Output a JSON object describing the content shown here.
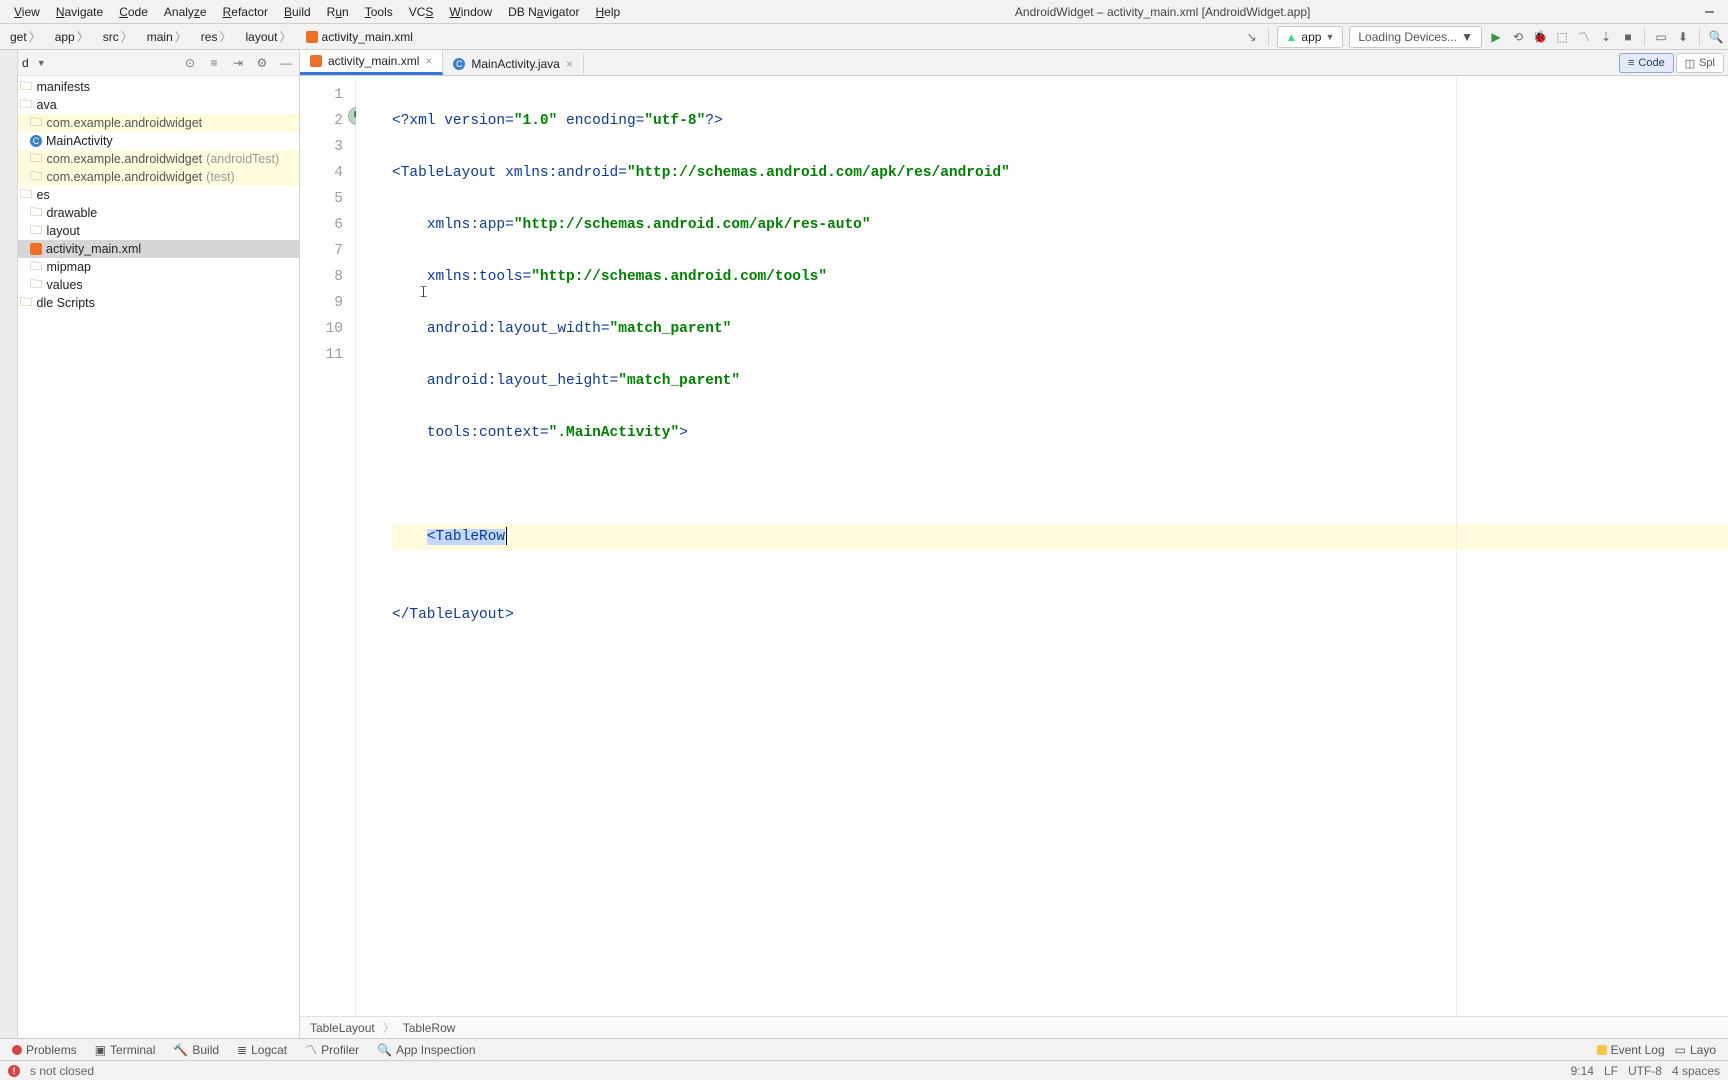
{
  "menubar": {
    "items": [
      "View",
      "Navigate",
      "Code",
      "Analyze",
      "Refactor",
      "Build",
      "Run",
      "Tools",
      "VCS",
      "Window",
      "DB Navigator",
      "Help"
    ],
    "title": "AndroidWidget – activity_main.xml [AndroidWidget.app]"
  },
  "breadcrumbs": [
    "get",
    "app",
    "src",
    "main",
    "res",
    "layout",
    "activity_main.xml"
  ],
  "toolbar": {
    "run_config": "app",
    "loading_devices": "Loading Devices..."
  },
  "project": {
    "header": "d",
    "tree": [
      {
        "label": "manifests",
        "type": "folder",
        "lvl": 0
      },
      {
        "label": "ava",
        "type": "folder",
        "lvl": 0
      },
      {
        "label": "com.example.androidwidget",
        "type": "pkg",
        "lvl": 1,
        "hl": true
      },
      {
        "label": "MainActivity",
        "type": "class",
        "lvl": 2
      },
      {
        "label": "com.example.androidwidget",
        "suffix": "(androidTest)",
        "type": "pkg",
        "lvl": 1,
        "hl": true
      },
      {
        "label": "com.example.androidwidget",
        "suffix": "(test)",
        "type": "pkg",
        "lvl": 1,
        "hl": true
      },
      {
        "label": "es",
        "type": "folder",
        "lvl": 0
      },
      {
        "label": "drawable",
        "type": "folder",
        "lvl": 1
      },
      {
        "label": "layout",
        "type": "folder",
        "lvl": 1
      },
      {
        "label": "activity_main.xml",
        "type": "xml",
        "lvl": 2,
        "selected": true
      },
      {
        "label": "mipmap",
        "type": "folder",
        "lvl": 1
      },
      {
        "label": "values",
        "type": "folder",
        "lvl": 1
      },
      {
        "label": "dle Scripts",
        "type": "folder",
        "lvl": 0
      }
    ]
  },
  "tabs": {
    "active": "activity_main.xml",
    "other": "MainActivity.java"
  },
  "viewtabs": {
    "code": "Code",
    "split": "Spl"
  },
  "code": {
    "lines": {
      "l1_a": "<?",
      "l1_b": "xml version=",
      "l1_c": "\"1.0\"",
      "l1_d": " encoding=",
      "l1_e": "\"utf-8\"",
      "l1_f": "?>",
      "l2_a": "<",
      "l2_b": "TableLayout ",
      "l2_c": "xmlns:android=",
      "l2_d": "\"http://schemas.android.com/apk/res/android\"",
      "l3_a": "    ",
      "l3_b": "xmlns:app=",
      "l3_c": "\"http://schemas.android.com/apk/res-auto\"",
      "l4_a": "    ",
      "l4_b": "xmlns:tools=",
      "l4_c": "\"http://schemas.android.com/tools\"",
      "l5_a": "    ",
      "l5_b": "android:layout_width=",
      "l5_c": "\"match_parent\"",
      "l6_a": "    ",
      "l6_b": "android:layout_height=",
      "l6_c": "\"match_parent\"",
      "l7_a": "    ",
      "l7_b": "tools:context=",
      "l7_c": "\".MainActivity\"",
      "l7_d": ">",
      "l9_a": "    ",
      "l9_b": "<",
      "l9_c": "TableRow",
      "l11_a": "</",
      "l11_b": "TableLayout",
      "l11_c": ">"
    },
    "line_numbers": [
      "1",
      "2",
      "3",
      "4",
      "5",
      "6",
      "7",
      "8",
      "9",
      "10",
      "11"
    ],
    "gutter_marker_line": 2
  },
  "breadcrumb_tags": [
    "TableLayout",
    "TableRow"
  ],
  "bottom_tools": {
    "problems": "Problems",
    "terminal": "Terminal",
    "build": "Build",
    "logcat": "Logcat",
    "profiler": "Profiler",
    "appinspect": "App Inspection",
    "eventlog": "Event Log",
    "layout": "Layo"
  },
  "status": {
    "msg": "s not closed",
    "pos": "9:14",
    "lineend": "LF",
    "encoding": "UTF-8",
    "indent": "4 spaces"
  }
}
